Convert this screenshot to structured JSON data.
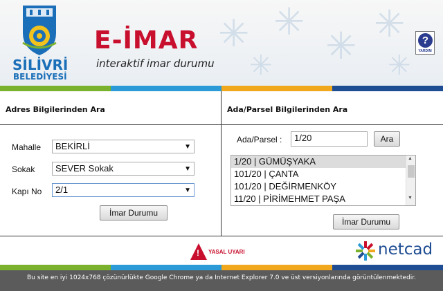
{
  "header": {
    "logo_line1": "SİLİVRİ",
    "logo_line2": "BELEDİYESİ",
    "title": "E-İMAR",
    "subtitle": "interaktif imar durumu",
    "help_label": "YARDIM",
    "help_symbol": "?"
  },
  "left_panel": {
    "heading": "Adres Bilgilerinden Ara",
    "mahalle_label": "Mahalle",
    "mahalle_value": "BEKİRLİ",
    "sokak_label": "Sokak",
    "sokak_value": "SEVER Sokak",
    "kapi_label": "Kapı No",
    "kapi_value": "2/1",
    "button_label": "İmar Durumu"
  },
  "right_panel": {
    "heading": "Ada/Parsel Bilgilerinden Ara",
    "ada_label": "Ada/Parsel :",
    "ada_value": "1/20",
    "search_button": "Ara",
    "results": [
      "1/20 | GÜMÜŞYAKA",
      "101/20 | ÇANTA",
      "101/20 | DEĞİRMENKÖY",
      "11/20 | PİRİMEHMET PAŞA"
    ],
    "button_label": "İmar Durumu"
  },
  "footer": {
    "warning_label": "YASAL UYARI",
    "netcad_label": "netcad",
    "notice": "Bu site en iyi 1024x768 çözünürlükte Google Chrome ya da Internet Explorer 7.0 ve üst versiyonlarında görüntülenmektedir."
  },
  "colors": {
    "brand_red": "#c8102e",
    "brand_blue": "#1b6fb8",
    "stripe": [
      "#7ab12d",
      "#2b9ad6",
      "#f2a81d",
      "#1f4d93"
    ]
  }
}
